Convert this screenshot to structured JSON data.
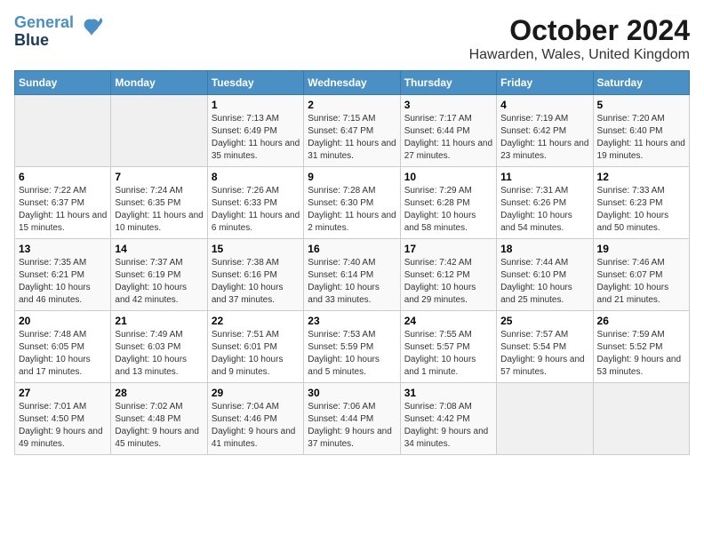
{
  "logo": {
    "line1": "General",
    "line2": "Blue"
  },
  "title": "October 2024",
  "subtitle": "Hawarden, Wales, United Kingdom",
  "weekdays": [
    "Sunday",
    "Monday",
    "Tuesday",
    "Wednesday",
    "Thursday",
    "Friday",
    "Saturday"
  ],
  "weeks": [
    [
      {
        "day": "",
        "info": ""
      },
      {
        "day": "",
        "info": ""
      },
      {
        "day": "1",
        "info": "Sunrise: 7:13 AM\nSunset: 6:49 PM\nDaylight: 11 hours and 35 minutes."
      },
      {
        "day": "2",
        "info": "Sunrise: 7:15 AM\nSunset: 6:47 PM\nDaylight: 11 hours and 31 minutes."
      },
      {
        "day": "3",
        "info": "Sunrise: 7:17 AM\nSunset: 6:44 PM\nDaylight: 11 hours and 27 minutes."
      },
      {
        "day": "4",
        "info": "Sunrise: 7:19 AM\nSunset: 6:42 PM\nDaylight: 11 hours and 23 minutes."
      },
      {
        "day": "5",
        "info": "Sunrise: 7:20 AM\nSunset: 6:40 PM\nDaylight: 11 hours and 19 minutes."
      }
    ],
    [
      {
        "day": "6",
        "info": "Sunrise: 7:22 AM\nSunset: 6:37 PM\nDaylight: 11 hours and 15 minutes."
      },
      {
        "day": "7",
        "info": "Sunrise: 7:24 AM\nSunset: 6:35 PM\nDaylight: 11 hours and 10 minutes."
      },
      {
        "day": "8",
        "info": "Sunrise: 7:26 AM\nSunset: 6:33 PM\nDaylight: 11 hours and 6 minutes."
      },
      {
        "day": "9",
        "info": "Sunrise: 7:28 AM\nSunset: 6:30 PM\nDaylight: 11 hours and 2 minutes."
      },
      {
        "day": "10",
        "info": "Sunrise: 7:29 AM\nSunset: 6:28 PM\nDaylight: 10 hours and 58 minutes."
      },
      {
        "day": "11",
        "info": "Sunrise: 7:31 AM\nSunset: 6:26 PM\nDaylight: 10 hours and 54 minutes."
      },
      {
        "day": "12",
        "info": "Sunrise: 7:33 AM\nSunset: 6:23 PM\nDaylight: 10 hours and 50 minutes."
      }
    ],
    [
      {
        "day": "13",
        "info": "Sunrise: 7:35 AM\nSunset: 6:21 PM\nDaylight: 10 hours and 46 minutes."
      },
      {
        "day": "14",
        "info": "Sunrise: 7:37 AM\nSunset: 6:19 PM\nDaylight: 10 hours and 42 minutes."
      },
      {
        "day": "15",
        "info": "Sunrise: 7:38 AM\nSunset: 6:16 PM\nDaylight: 10 hours and 37 minutes."
      },
      {
        "day": "16",
        "info": "Sunrise: 7:40 AM\nSunset: 6:14 PM\nDaylight: 10 hours and 33 minutes."
      },
      {
        "day": "17",
        "info": "Sunrise: 7:42 AM\nSunset: 6:12 PM\nDaylight: 10 hours and 29 minutes."
      },
      {
        "day": "18",
        "info": "Sunrise: 7:44 AM\nSunset: 6:10 PM\nDaylight: 10 hours and 25 minutes."
      },
      {
        "day": "19",
        "info": "Sunrise: 7:46 AM\nSunset: 6:07 PM\nDaylight: 10 hours and 21 minutes."
      }
    ],
    [
      {
        "day": "20",
        "info": "Sunrise: 7:48 AM\nSunset: 6:05 PM\nDaylight: 10 hours and 17 minutes."
      },
      {
        "day": "21",
        "info": "Sunrise: 7:49 AM\nSunset: 6:03 PM\nDaylight: 10 hours and 13 minutes."
      },
      {
        "day": "22",
        "info": "Sunrise: 7:51 AM\nSunset: 6:01 PM\nDaylight: 10 hours and 9 minutes."
      },
      {
        "day": "23",
        "info": "Sunrise: 7:53 AM\nSunset: 5:59 PM\nDaylight: 10 hours and 5 minutes."
      },
      {
        "day": "24",
        "info": "Sunrise: 7:55 AM\nSunset: 5:57 PM\nDaylight: 10 hours and 1 minute."
      },
      {
        "day": "25",
        "info": "Sunrise: 7:57 AM\nSunset: 5:54 PM\nDaylight: 9 hours and 57 minutes."
      },
      {
        "day": "26",
        "info": "Sunrise: 7:59 AM\nSunset: 5:52 PM\nDaylight: 9 hours and 53 minutes."
      }
    ],
    [
      {
        "day": "27",
        "info": "Sunrise: 7:01 AM\nSunset: 4:50 PM\nDaylight: 9 hours and 49 minutes."
      },
      {
        "day": "28",
        "info": "Sunrise: 7:02 AM\nSunset: 4:48 PM\nDaylight: 9 hours and 45 minutes."
      },
      {
        "day": "29",
        "info": "Sunrise: 7:04 AM\nSunset: 4:46 PM\nDaylight: 9 hours and 41 minutes."
      },
      {
        "day": "30",
        "info": "Sunrise: 7:06 AM\nSunset: 4:44 PM\nDaylight: 9 hours and 37 minutes."
      },
      {
        "day": "31",
        "info": "Sunrise: 7:08 AM\nSunset: 4:42 PM\nDaylight: 9 hours and 34 minutes."
      },
      {
        "day": "",
        "info": ""
      },
      {
        "day": "",
        "info": ""
      }
    ]
  ]
}
